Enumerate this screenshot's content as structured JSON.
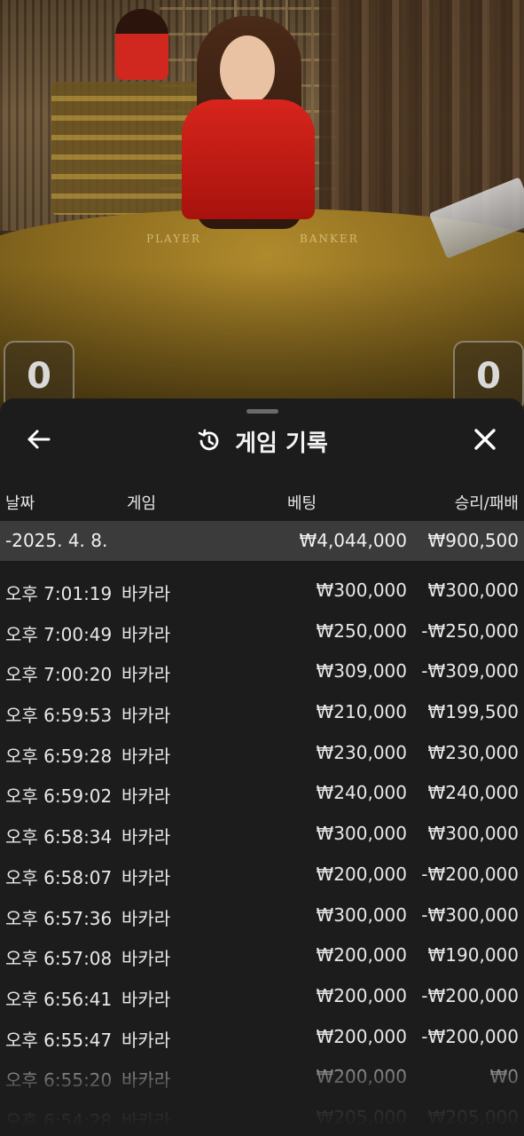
{
  "scores": {
    "player": "0",
    "banker": "0"
  },
  "table_labels": {
    "player": "PLAYER",
    "banker": "BANKER"
  },
  "header": {
    "title": "게임 기록"
  },
  "columns": {
    "date": "날짜",
    "game": "게임",
    "bet": "베팅",
    "win_loss": "승리/패배"
  },
  "summary": {
    "date": "-2025. 4. 8.",
    "bet": "₩4,044,000",
    "win_loss": "₩900,500"
  },
  "records": [
    {
      "time": "오후 7:01:19",
      "game": "바카라",
      "bet": "₩300,000",
      "win_loss": "₩300,000"
    },
    {
      "time": "오후 7:00:49",
      "game": "바카라",
      "bet": "₩250,000",
      "win_loss": "-₩250,000"
    },
    {
      "time": "오후 7:00:20",
      "game": "바카라",
      "bet": "₩309,000",
      "win_loss": "-₩309,000"
    },
    {
      "time": "오후 6:59:53",
      "game": "바카라",
      "bet": "₩210,000",
      "win_loss": "₩199,500"
    },
    {
      "time": "오후 6:59:28",
      "game": "바카라",
      "bet": "₩230,000",
      "win_loss": "₩230,000"
    },
    {
      "time": "오후 6:59:02",
      "game": "바카라",
      "bet": "₩240,000",
      "win_loss": "₩240,000"
    },
    {
      "time": "오후 6:58:34",
      "game": "바카라",
      "bet": "₩300,000",
      "win_loss": "₩300,000"
    },
    {
      "time": "오후 6:58:07",
      "game": "바카라",
      "bet": "₩200,000",
      "win_loss": "-₩200,000"
    },
    {
      "time": "오후 6:57:36",
      "game": "바카라",
      "bet": "₩300,000",
      "win_loss": "-₩300,000"
    },
    {
      "time": "오후 6:57:08",
      "game": "바카라",
      "bet": "₩200,000",
      "win_loss": "₩190,000"
    },
    {
      "time": "오후 6:56:41",
      "game": "바카라",
      "bet": "₩200,000",
      "win_loss": "-₩200,000"
    },
    {
      "time": "오후 6:55:47",
      "game": "바카라",
      "bet": "₩200,000",
      "win_loss": "-₩200,000"
    },
    {
      "time": "오후 6:55:20",
      "game": "바카라",
      "bet": "₩200,000",
      "win_loss": "₩0"
    },
    {
      "time": "오후 6:54:28",
      "game": "바카라",
      "bet": "₩205,000",
      "win_loss": "₩205,000"
    }
  ],
  "icons": {
    "back": "arrow-left-icon",
    "history": "history-icon",
    "close": "close-icon"
  },
  "colors": {
    "panel_bg": "#1c1c1c",
    "summary_row_bg": "#3b3b3b",
    "table_felt": "#a8842a"
  }
}
